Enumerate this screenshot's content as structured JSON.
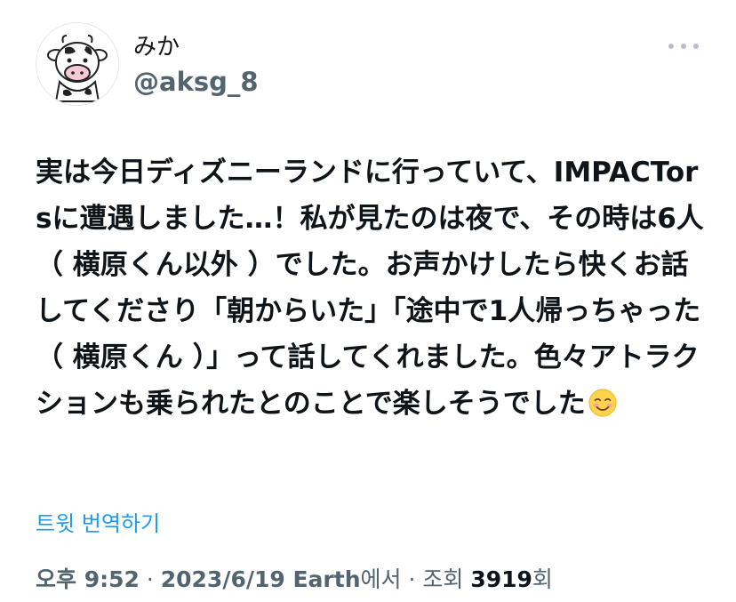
{
  "user": {
    "display_name": "みか",
    "handle": "@aksg_8",
    "avatar_icon": "cow-avatar-icon"
  },
  "more_icon": "more-options-icon",
  "tweet": {
    "text": "実は今日ディズニーランドに行っていて、IMPACTorsに遭遇しました…！私が見たのは夜で、その時は6人（ 横原くん以外 ）でした。お声かけしたら快くお話してくださり「朝からいた」「途中で1人帰っちゃった（ 横原くん ）」って話してくれました。色々アトラクションも乗られたとのことで楽しそうでした",
    "emoji_icon": "smiling-face-icon"
  },
  "translate_label": "트윗 번역하기",
  "meta": {
    "time": "오후 9:52",
    "sep1": " · ",
    "date": "2023/6/19",
    "source": " Earth",
    "source_suffix": "에서",
    "sep2": " · ",
    "views_label": "조회 ",
    "views_count": "3919",
    "views_suffix": "회"
  },
  "colors": {
    "link": "#1d9bf0",
    "secondary": "#536471",
    "text": "#0f1419"
  }
}
